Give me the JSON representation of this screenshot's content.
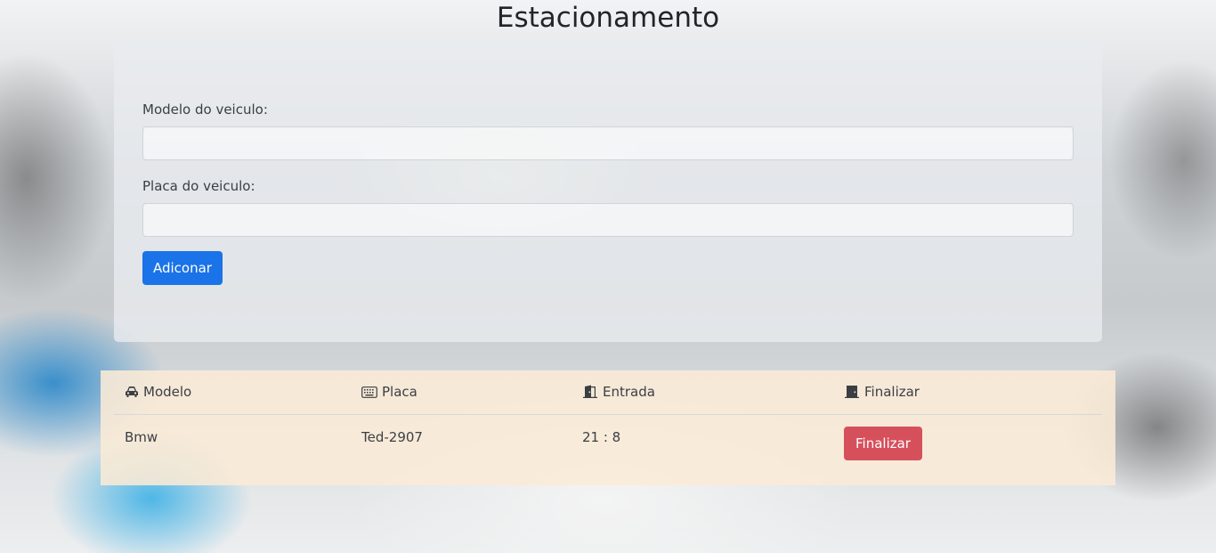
{
  "page": {
    "title": "Estacionamento"
  },
  "form": {
    "modelo_label": "Modelo do veiculo:",
    "modelo_value": "",
    "placa_label": "Placa do veiculo:",
    "placa_value": "",
    "submit_label": "Adiconar"
  },
  "table": {
    "columns": [
      {
        "label": "Modelo",
        "icon": "car-icon"
      },
      {
        "label": "Placa",
        "icon": "keyboard-icon"
      },
      {
        "label": "Entrada",
        "icon": "door-open-icon"
      },
      {
        "label": "Finalizar",
        "icon": "door-closed-icon"
      }
    ],
    "rows": [
      {
        "modelo": "Bmw",
        "placa": "Ted-2907",
        "entrada": "21 : 8",
        "action_label": "Finalizar"
      }
    ]
  },
  "colors": {
    "primary": "#1a73e8",
    "danger": "#d6505c",
    "table_bg": "#fbead6",
    "card_bg": "#e9ecef"
  }
}
